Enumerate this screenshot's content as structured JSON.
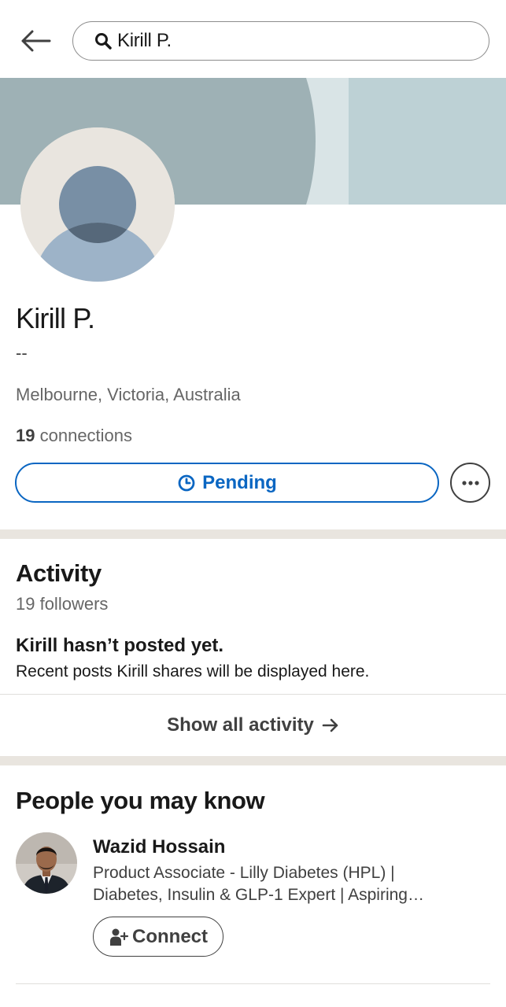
{
  "search": {
    "query": "Kirill P."
  },
  "profile": {
    "name": "Kirill P.",
    "headline": "--",
    "location": "Melbourne, Victoria, Australia",
    "connections_count": "19",
    "connections_label": "connections",
    "pending_label": "Pending"
  },
  "activity": {
    "title": "Activity",
    "followers": "19 followers",
    "empty_title": "Kirill hasn’t posted yet.",
    "empty_subtitle": "Recent posts Kirill shares will be displayed here.",
    "show_all_label": "Show all activity"
  },
  "people": {
    "title": "People you may know",
    "items": [
      {
        "name": "Wazid Hossain",
        "headline": "Product Associate - Lilly Diabetes (HPL) | Diabetes, Insulin & GLP-1 Expert | Aspiring Leader",
        "action_label": "Connect"
      }
    ]
  },
  "colors": {
    "accent": "#0a66c2",
    "divider": "#e9e5df",
    "banner_dark": "#9eb1b5",
    "banner_light": "#d9e4e6",
    "banner_mid": "#bdd1d5"
  }
}
